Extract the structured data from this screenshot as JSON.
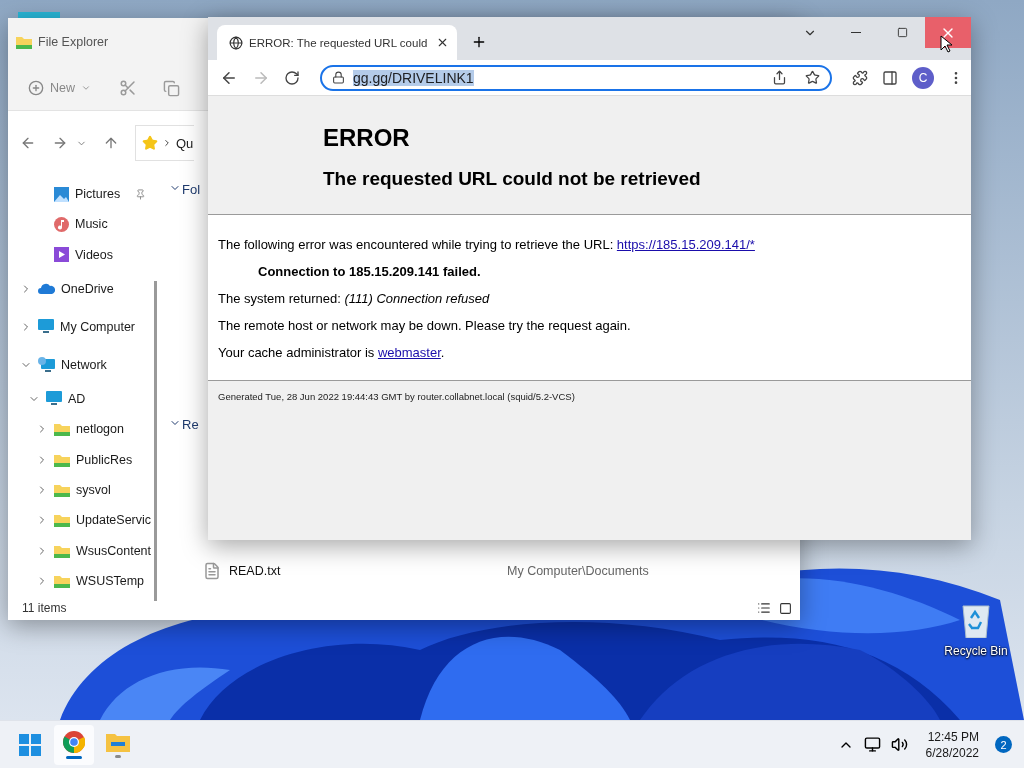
{
  "desktop": {
    "recycle_bin": {
      "label": "Recycle Bin"
    }
  },
  "explorer": {
    "title": "File Explorer",
    "new_label": "New",
    "breadcrumb": "Qu",
    "sidebar": [
      {
        "kind": "pictures",
        "label": "Pictures",
        "pinned": true
      },
      {
        "kind": "music",
        "label": "Music"
      },
      {
        "kind": "videos",
        "label": "Videos"
      },
      {
        "kind": "onedrive",
        "label": "OneDrive",
        "expanded": false
      },
      {
        "kind": "computer",
        "label": "My Computer",
        "expanded": false
      },
      {
        "kind": "network",
        "label": "Network",
        "expanded": true,
        "children": [
          {
            "kind": "computer",
            "label": "AD",
            "expanded": true,
            "children": [
              {
                "kind": "folder",
                "label": "netlogon",
                "expanded": false
              },
              {
                "kind": "folder",
                "label": "PublicRes",
                "expanded": false
              },
              {
                "kind": "folder",
                "label": "sysvol",
                "expanded": false
              },
              {
                "kind": "folder",
                "label": "UpdateServic",
                "expanded": false
              },
              {
                "kind": "folder",
                "label": "WsusContent",
                "expanded": false
              },
              {
                "kind": "folder",
                "label": "WSUSTemp",
                "expanded": false
              }
            ]
          }
        ]
      }
    ],
    "sections": [
      {
        "heading": "Fol",
        "expanded": true
      },
      {
        "heading": "Re",
        "expanded": true
      }
    ],
    "files": [
      {
        "name": "READ.txt",
        "location": "My Computer\\Documents"
      }
    ],
    "status": "11 items"
  },
  "browser": {
    "tab_title": "ERROR: The requested URL could",
    "close_hovered": true,
    "address": "gg.gg/DRIVELINK1",
    "address_selected": true,
    "forward_disabled": true,
    "profile_initial": "C",
    "page": {
      "title": "ERROR",
      "subtitle": "The requested URL could not be retrieved",
      "paragraphs": [
        {
          "kind": "link",
          "before": "The following error was encountered while trying to retrieve the URL: ",
          "link": "https://185.15.209.141/*"
        },
        {
          "kind": "quote",
          "text": "Connection to 185.15.209.141 failed."
        },
        {
          "kind": "text",
          "text": "The system returned: *(111) Connection refused*"
        },
        {
          "kind": "text",
          "text": "The remote host or network may be down. Please try the request again."
        },
        {
          "kind": "link",
          "before": "Your cache administrator is ",
          "link": "webmaster",
          "after": "."
        }
      ],
      "footer": "Generated Tue, 28 Jun 2022 19:44:43 GMT by router.collabnet.local (squid/5.2-VCS)"
    }
  },
  "taskbar": {
    "apps": [
      {
        "kind": "chrome",
        "selected": true
      },
      {
        "kind": "explorer",
        "selected": false
      }
    ],
    "time": "12:45 PM",
    "date": "6/28/2022",
    "notifications": "2"
  }
}
